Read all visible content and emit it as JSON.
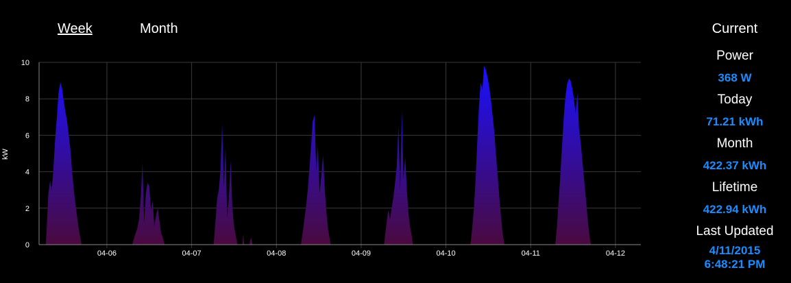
{
  "tabs": {
    "week_label": "Week",
    "month_label": "Month",
    "active": "week"
  },
  "side": {
    "title": "Current",
    "power_label": "Power",
    "power_value": "368 W",
    "today_label": "Today",
    "today_value": "71.21 kWh",
    "month_label": "Month",
    "month_value": "422.37 kWh",
    "lifetime_label": "Lifetime",
    "lifetime_value": "422.94 kWh",
    "updated_label": "Last Updated",
    "updated_date": "4/11/2015",
    "updated_time": "6:48:21 PM"
  },
  "colors": {
    "background": "#000000",
    "grid": "#3a3a3a",
    "fill_top": "#1a10ff",
    "fill_bottom": "#4a0a3f",
    "value_accent": "#1a8cff"
  },
  "chart_data": {
    "type": "area",
    "ylabel": "kW",
    "xlabel": "",
    "ylim": [
      0,
      10
    ],
    "yticks": [
      0,
      2,
      4,
      6,
      8,
      10
    ],
    "xlim": [
      5.2,
      12.3
    ],
    "xticks": [
      {
        "pos": 6,
        "label": "04-06"
      },
      {
        "pos": 7,
        "label": "04-07"
      },
      {
        "pos": 8,
        "label": "04-08"
      },
      {
        "pos": 9,
        "label": "04-09"
      },
      {
        "pos": 10,
        "label": "04-10"
      },
      {
        "pos": 11,
        "label": "04-11"
      },
      {
        "pos": 12,
        "label": "04-12"
      }
    ],
    "grid": true,
    "series": [
      {
        "points": [
          [
            5.28,
            0
          ],
          [
            5.31,
            2.8
          ],
          [
            5.33,
            3.5
          ],
          [
            5.35,
            3.0
          ],
          [
            5.37,
            4.2
          ],
          [
            5.39,
            5.8
          ],
          [
            5.41,
            7.0
          ],
          [
            5.43,
            8.3
          ],
          [
            5.45,
            8.9
          ],
          [
            5.47,
            8.6
          ],
          [
            5.49,
            7.9
          ],
          [
            5.51,
            7.3
          ],
          [
            5.53,
            6.8
          ],
          [
            5.55,
            6.0
          ],
          [
            5.57,
            5.2
          ],
          [
            5.59,
            4.0
          ],
          [
            5.61,
            3.0
          ],
          [
            5.63,
            2.2
          ],
          [
            5.65,
            1.5
          ],
          [
            5.67,
            0.8
          ],
          [
            5.69,
            0.3
          ],
          [
            5.7,
            0
          ],
          [
            6.3,
            0
          ],
          [
            6.33,
            0.5
          ],
          [
            6.36,
            0.9
          ],
          [
            6.38,
            1.4
          ],
          [
            6.4,
            2.6
          ],
          [
            6.42,
            4.5
          ],
          [
            6.44,
            1.2
          ],
          [
            6.46,
            2.8
          ],
          [
            6.48,
            3.4
          ],
          [
            6.5,
            3.2
          ],
          [
            6.52,
            1.9
          ],
          [
            6.54,
            2.4
          ],
          [
            6.56,
            1.0
          ],
          [
            6.58,
            1.6
          ],
          [
            6.6,
            2.0
          ],
          [
            6.62,
            1.3
          ],
          [
            6.64,
            0.6
          ],
          [
            6.66,
            0.4
          ],
          [
            6.68,
            0
          ],
          [
            7.26,
            0
          ],
          [
            7.28,
            1.2
          ],
          [
            7.3,
            2.5
          ],
          [
            7.32,
            3.0
          ],
          [
            7.34,
            4.0
          ],
          [
            7.36,
            6.6
          ],
          [
            7.38,
            3.2
          ],
          [
            7.4,
            5.3
          ],
          [
            7.42,
            1.5
          ],
          [
            7.44,
            2.6
          ],
          [
            7.46,
            4.6
          ],
          [
            7.48,
            2.1
          ],
          [
            7.5,
            1.0
          ],
          [
            7.52,
            0.5
          ],
          [
            7.54,
            0
          ],
          [
            7.6,
            0
          ],
          [
            7.61,
            0.6
          ],
          [
            7.62,
            0
          ],
          [
            7.68,
            0
          ],
          [
            7.7,
            0.4
          ],
          [
            7.72,
            0
          ],
          [
            8.29,
            0
          ],
          [
            8.32,
            1.0
          ],
          [
            8.35,
            2.1
          ],
          [
            8.37,
            3.0
          ],
          [
            8.39,
            4.2
          ],
          [
            8.41,
            5.5
          ],
          [
            8.43,
            6.8
          ],
          [
            8.45,
            7.1
          ],
          [
            8.47,
            4.0
          ],
          [
            8.49,
            5.4
          ],
          [
            8.51,
            2.8
          ],
          [
            8.53,
            3.8
          ],
          [
            8.55,
            4.9
          ],
          [
            8.57,
            3.1
          ],
          [
            8.59,
            1.8
          ],
          [
            8.61,
            0.8
          ],
          [
            8.63,
            0.3
          ],
          [
            8.64,
            0
          ],
          [
            9.27,
            0
          ],
          [
            9.3,
            1.2
          ],
          [
            9.32,
            1.9
          ],
          [
            9.34,
            1.4
          ],
          [
            9.36,
            2.0
          ],
          [
            9.38,
            2.6
          ],
          [
            9.4,
            3.4
          ],
          [
            9.42,
            4.3
          ],
          [
            9.44,
            6.5
          ],
          [
            9.46,
            3.0
          ],
          [
            9.48,
            7.3
          ],
          [
            9.5,
            3.6
          ],
          [
            9.52,
            4.8
          ],
          [
            9.54,
            2.9
          ],
          [
            9.56,
            1.6
          ],
          [
            9.58,
            0.9
          ],
          [
            9.6,
            0.4
          ],
          [
            9.61,
            0
          ],
          [
            10.29,
            0
          ],
          [
            10.31,
            0.9
          ],
          [
            10.33,
            2.0
          ],
          [
            10.35,
            3.6
          ],
          [
            10.37,
            5.6
          ],
          [
            10.39,
            7.6
          ],
          [
            10.41,
            8.9
          ],
          [
            10.43,
            8.5
          ],
          [
            10.45,
            9.8
          ],
          [
            10.47,
            9.6
          ],
          [
            10.49,
            9.2
          ],
          [
            10.51,
            8.7
          ],
          [
            10.53,
            8.0
          ],
          [
            10.55,
            7.1
          ],
          [
            10.57,
            6.2
          ],
          [
            10.59,
            5.0
          ],
          [
            10.61,
            3.8
          ],
          [
            10.63,
            2.6
          ],
          [
            10.65,
            1.5
          ],
          [
            10.67,
            0.6
          ],
          [
            10.69,
            0
          ],
          [
            11.29,
            0
          ],
          [
            11.31,
            1.0
          ],
          [
            11.33,
            2.4
          ],
          [
            11.35,
            3.8
          ],
          [
            11.37,
            5.4
          ],
          [
            11.39,
            7.0
          ],
          [
            11.41,
            8.1
          ],
          [
            11.43,
            8.8
          ],
          [
            11.45,
            9.1
          ],
          [
            11.47,
            9.0
          ],
          [
            11.49,
            8.6
          ],
          [
            11.51,
            8.0
          ],
          [
            11.53,
            7.2
          ],
          [
            11.55,
            8.3
          ],
          [
            11.57,
            6.4
          ],
          [
            11.59,
            5.6
          ],
          [
            11.61,
            4.6
          ],
          [
            11.63,
            3.6
          ],
          [
            11.65,
            2.6
          ],
          [
            11.67,
            1.5
          ],
          [
            11.69,
            0.6
          ],
          [
            11.71,
            0
          ]
        ]
      }
    ]
  }
}
